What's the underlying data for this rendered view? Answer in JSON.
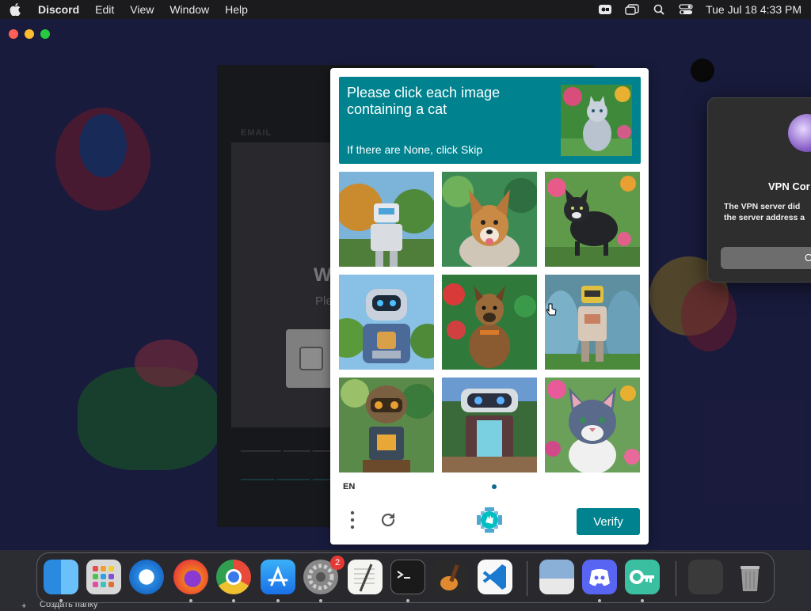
{
  "menubar": {
    "app_name": "Discord",
    "items": [
      "Edit",
      "View",
      "Window",
      "Help"
    ],
    "datetime": "Tue Jul 18  4:33 PM"
  },
  "auth": {
    "email_label": "EMAIL",
    "welcome_partial": "W",
    "please_partial": "Ple"
  },
  "vpn_dialog": {
    "title": "VPN Cor",
    "message_line1": "The VPN server did",
    "message_line2": "the server address a",
    "button": "O"
  },
  "captcha": {
    "title": "Please click each image containing a cat",
    "hint": "If there are None, click Skip",
    "language": "EN",
    "verify_label": "Verify",
    "tiles": [
      "robot",
      "dog",
      "cat",
      "robot",
      "dog",
      "robot",
      "robot",
      "robot",
      "cat"
    ]
  },
  "dock": {
    "apps": [
      "Finder",
      "Launchpad",
      "Safari",
      "Firefox",
      "Chrome",
      "App Store",
      "System Settings",
      "TextEdit",
      "Terminal",
      "GarageBand",
      "Visual Studio Code",
      "Preview",
      "Discord",
      "Passwords",
      "Downloads",
      "Trash"
    ],
    "settings_badge": "2"
  },
  "desktop_text": "Создать папку",
  "colors": {
    "accent": "#00838f",
    "menubar": "#1b1b1d",
    "discord_bg": "#2f3270"
  }
}
